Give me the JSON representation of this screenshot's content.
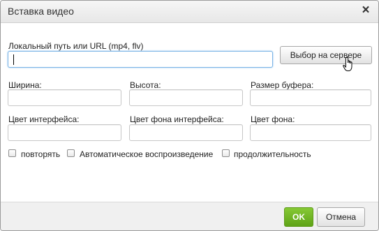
{
  "dialog": {
    "title": "Вставка видео",
    "close_icon": "close-icon"
  },
  "form": {
    "path_label": "Локальный путь или URL (mp4, flv)",
    "path_value": "",
    "browse_button": "Выбор на сервере",
    "width_label": "Ширина:",
    "height_label": "Высота:",
    "buffer_label": "Размер буфера:",
    "ui_color_label": "Цвет интерфейса:",
    "ui_bg_color_label": "Цвет фона интерфейса:",
    "bg_color_label": "Цвет фона:",
    "checkboxes": [
      {
        "label": "повторять",
        "checked": false
      },
      {
        "label": "Автоматическое воспроизведение",
        "checked": false
      },
      {
        "label": "продолжительность",
        "checked": false
      }
    ]
  },
  "footer": {
    "ok_label": "OK",
    "cancel_label": "Отмена"
  },
  "colors": {
    "ok_button": "#6db423",
    "focus_border": "#7ab4e6"
  },
  "icons": {
    "cursor": "hand-pointer-icon"
  }
}
